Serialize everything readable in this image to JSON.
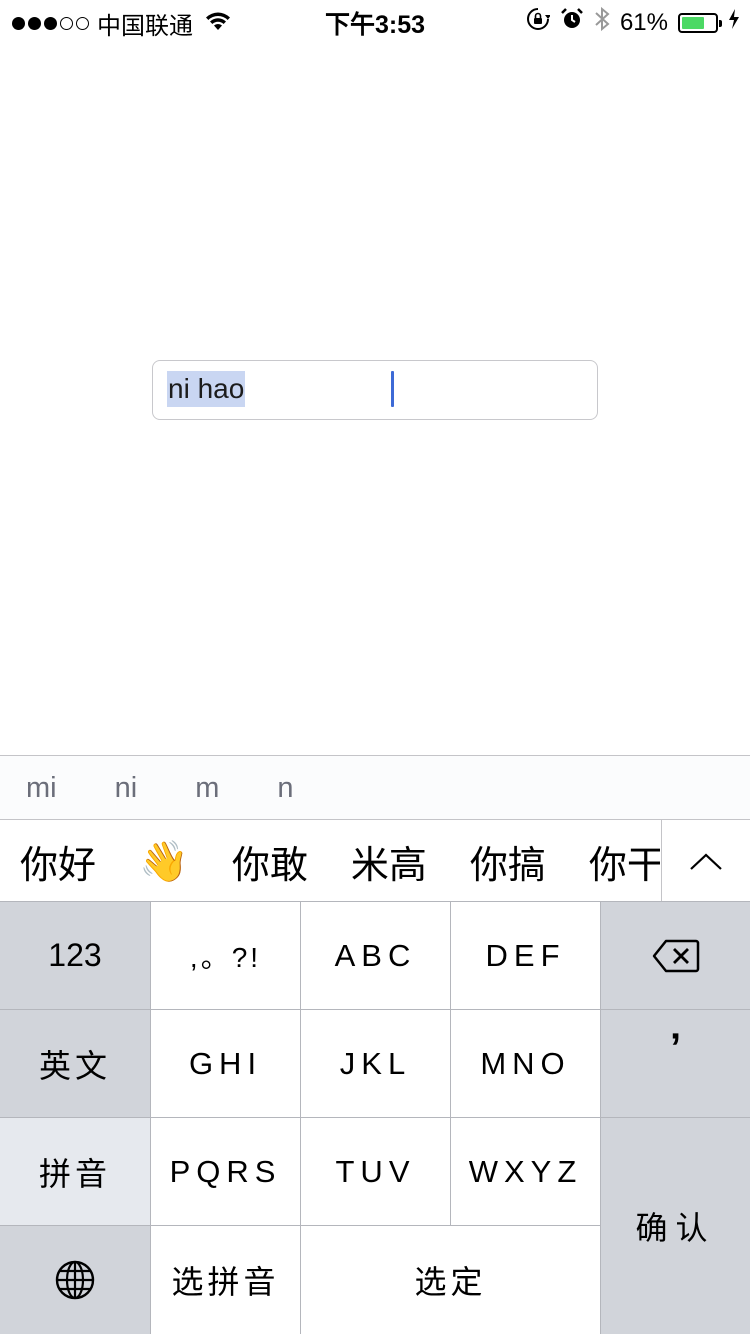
{
  "status_bar": {
    "carrier": "中国联通",
    "time": "下午3:53",
    "battery": "61%",
    "battery_level": 0.61,
    "signal_bars": 3,
    "signal_total": 5,
    "icons": [
      "wifi-icon",
      "rotation-lock-icon",
      "alarm-icon",
      "bluetooth-icon",
      "battery-icon",
      "charging-bolt-icon"
    ]
  },
  "text_field": {
    "value": "ni hao"
  },
  "keyboard": {
    "pinyin_options": [
      "mi",
      "ni",
      "m",
      "n"
    ],
    "candidates": [
      "你好",
      "👋",
      "你敢",
      "米高",
      "你搞",
      "你干"
    ],
    "keys": {
      "numbers": "123",
      "punct": ",。?!",
      "abc": "ABC",
      "def": "DEF",
      "english": "英文",
      "ghi": "GHI",
      "jkl": "JKL",
      "mno": "MNO",
      "apostrophe": "’",
      "pinyin": "拼音",
      "pqrs": "PQRS",
      "tuv": "TUV",
      "wxyz": "WXYZ",
      "confirm": "确认",
      "select_pinyin": "选拼音",
      "select": "选定"
    },
    "accent_gray": "#d1d4da",
    "selection_color": "#c9d6f2",
    "caret_color": "#3d6ad6"
  }
}
